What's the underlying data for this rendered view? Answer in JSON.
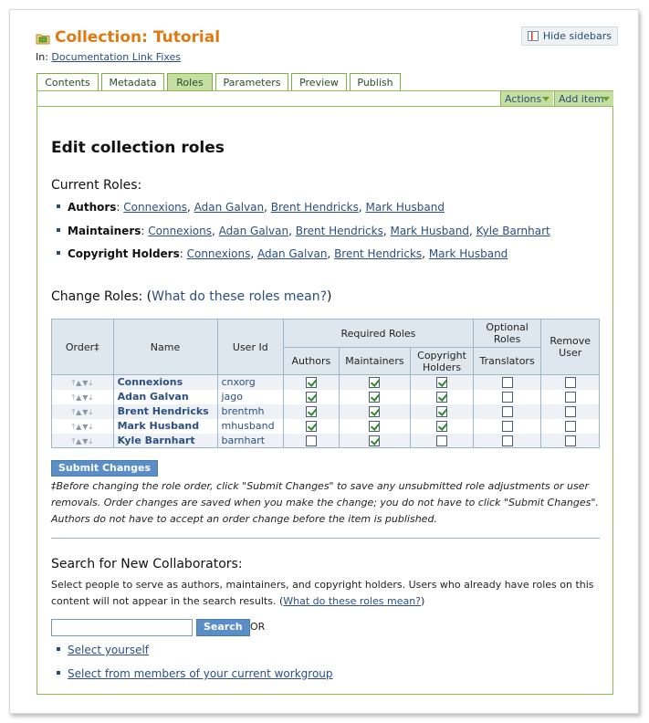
{
  "header": {
    "title": "Collection: Tutorial",
    "hide_sidebars": "Hide sidebars",
    "in_label": "In:",
    "in_link": "Documentation Link Fixes"
  },
  "tabs": [
    {
      "label": "Contents",
      "active": false
    },
    {
      "label": "Metadata",
      "active": false
    },
    {
      "label": "Roles",
      "active": true
    },
    {
      "label": "Parameters",
      "active": false
    },
    {
      "label": "Preview",
      "active": false
    },
    {
      "label": "Publish",
      "active": false
    }
  ],
  "actionbar": {
    "actions": "Actions",
    "add_item": "Add item"
  },
  "main": {
    "heading": "Edit collection roles",
    "current_roles_title": "Current Roles:",
    "current_roles": [
      {
        "role": "Authors",
        "people": [
          "Connexions",
          "Adan Galvan",
          "Brent Hendricks",
          "Mark Husband"
        ]
      },
      {
        "role": "Maintainers",
        "people": [
          "Connexions",
          "Adan Galvan",
          "Brent Hendricks",
          "Mark Husband",
          "Kyle Barnhart"
        ]
      },
      {
        "role": "Copyright Holders",
        "people": [
          "Connexions",
          "Adan Galvan",
          "Brent Hendricks",
          "Mark Husband"
        ]
      }
    ],
    "change_roles_title": "Change Roles: (",
    "change_roles_link": "What do these roles mean?",
    "change_roles_close": ")"
  },
  "table": {
    "headers": {
      "order": "Order‡",
      "name": "Name",
      "user_id": "User Id",
      "required_roles": "Required Roles",
      "optional_roles": "Optional Roles",
      "remove_user": "Remove User",
      "authors": "Authors",
      "maintainers": "Maintainers",
      "copyright_holders": "Copyright Holders",
      "translators": "Translators"
    },
    "rows": [
      {
        "name": "Connexions",
        "user_id": "cnxorg",
        "authors": true,
        "maintainers": true,
        "copyright": true,
        "translators": false,
        "remove": false
      },
      {
        "name": "Adan Galvan",
        "user_id": "jago",
        "authors": true,
        "maintainers": true,
        "copyright": true,
        "translators": false,
        "remove": false
      },
      {
        "name": "Brent Hendricks",
        "user_id": "brentmh",
        "authors": true,
        "maintainers": true,
        "copyright": true,
        "translators": false,
        "remove": false
      },
      {
        "name": "Mark Husband",
        "user_id": "mhusband",
        "authors": true,
        "maintainers": true,
        "copyright": true,
        "translators": false,
        "remove": false
      },
      {
        "name": "Kyle Barnhart",
        "user_id": "barnhart",
        "authors": false,
        "maintainers": true,
        "copyright": false,
        "translators": false,
        "remove": false
      }
    ]
  },
  "submit_label": "Submit Changes",
  "note": "‡Before changing the role order, click \"Submit Changes\" to save any unsubmitted role adjustments or user removals. Order changes are saved when you make the change; you do not have to click \"Submit Changes\". Authors do not have to accept an order change before the item is published.",
  "search": {
    "title": "Search for New Collaborators:",
    "description": "Select people to serve as authors, maintainers, and copyright holders. Users who already have roles on this content will not appear in the search results. (",
    "description_link": "What do these roles mean?",
    "description_close": ")",
    "input_value": "",
    "button_label": "Search",
    "or_label": "OR",
    "options": [
      "Select yourself",
      "Select from members of your current workgroup"
    ]
  }
}
